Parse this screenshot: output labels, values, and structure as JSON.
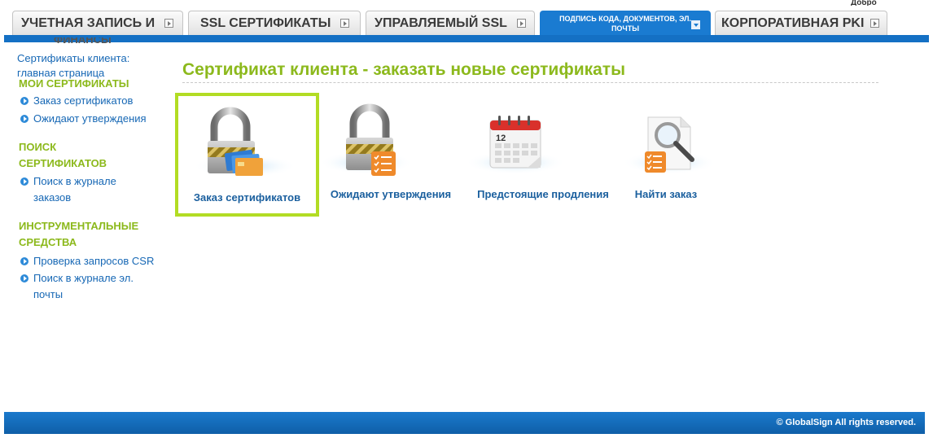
{
  "header": {
    "corner_text": "Добро",
    "tabs": [
      {
        "label": "УЧЕТНАЯ ЗАПИСЬ И",
        "active": false
      },
      {
        "label": "SSL СЕРТИФИКАТЫ",
        "active": false
      },
      {
        "label": "УПРАВЛЯЕМЫЙ SSL",
        "active": false
      },
      {
        "label": "ПОДПИСЬ КОДА, ДОКУМЕНТОВ, ЭЛ. ПОЧТЫ",
        "active": true
      },
      {
        "label": "КОРПОРАТИВНАЯ PKI",
        "active": false
      }
    ]
  },
  "sidebar": {
    "cut_heading": "ФИНАНСЫ",
    "home_link": "Сертификаты клиента: главная страница",
    "sections": [
      {
        "heading": "МОИ СЕРТИФИКАТЫ",
        "links": [
          "Заказ сертификатов",
          "Ожидают утверждения"
        ]
      },
      {
        "heading": "ПОИСК СЕРТИФИКАТОВ",
        "links": [
          "Поиск в журнале заказов"
        ]
      },
      {
        "heading": "ИНСТРУМЕНТАЛЬНЫЕ СРЕДСТВА",
        "links": [
          "Проверка запросов CSR",
          "Поиск в журнале эл. почты"
        ]
      }
    ]
  },
  "main": {
    "title": "Сертификат клиента - заказать новые сертификаты",
    "items": [
      {
        "label": "Заказ сертификатов",
        "icon": "padlock-cards-icon",
        "selected": true
      },
      {
        "label": "Ожидают утверждения",
        "icon": "padlock-checklist-icon",
        "selected": false
      },
      {
        "label": "Предстоящие продления",
        "icon": "calendar-icon",
        "selected": false,
        "calendar_day": "12"
      },
      {
        "label": "Найти заказ",
        "icon": "magnifier-document-icon",
        "selected": false
      }
    ]
  },
  "footer": {
    "copyright": "© GlobalSign All rights reserved."
  },
  "colors": {
    "accent_green": "#8cb91c",
    "brand_blue": "#1470c4",
    "link_blue": "#1768b5"
  }
}
